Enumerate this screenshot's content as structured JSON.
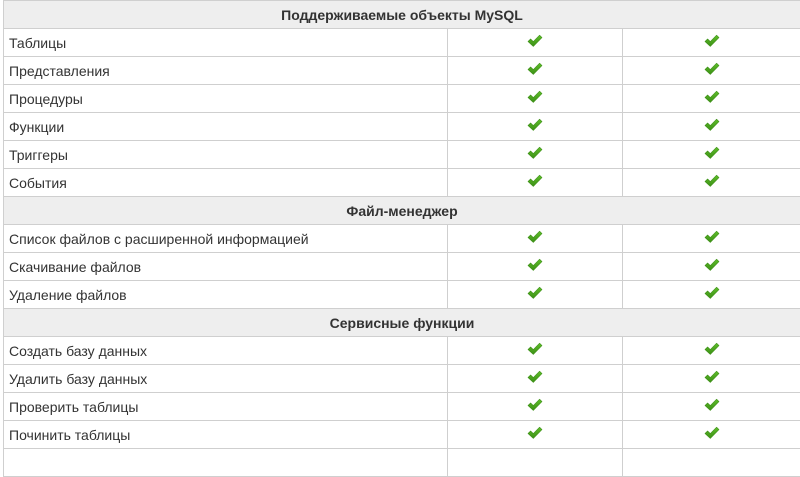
{
  "table": {
    "sections": [
      {
        "title": "Поддерживаемые объекты MySQL",
        "rows": [
          {
            "label": "Таблицы",
            "col1": "check",
            "col2": "check"
          },
          {
            "label": "Представления",
            "col1": "check",
            "col2": "check"
          },
          {
            "label": "Процедуры",
            "col1": "check",
            "col2": "check"
          },
          {
            "label": "Функции",
            "col1": "check",
            "col2": "check"
          },
          {
            "label": "Триггеры",
            "col1": "check",
            "col2": "check"
          },
          {
            "label": "События",
            "col1": "check",
            "col2": "check"
          }
        ]
      },
      {
        "title": "Файл-менеджер",
        "rows": [
          {
            "label": "Список файлов с расширенной информацией",
            "col1": "check",
            "col2": "check"
          },
          {
            "label": "Скачивание файлов",
            "col1": "check",
            "col2": "check"
          },
          {
            "label": "Удаление файлов",
            "col1": "check",
            "col2": "check"
          }
        ]
      },
      {
        "title": "Сервисные функции",
        "rows": [
          {
            "label": "Создать базу данных",
            "col1": "check",
            "col2": "check"
          },
          {
            "label": "Удалить базу данных",
            "col1": "check",
            "col2": "check"
          },
          {
            "label": "Проверить таблицы",
            "col1": "check",
            "col2": "check"
          },
          {
            "label": "Починить таблицы",
            "col1": "check",
            "col2": "check"
          }
        ]
      }
    ]
  },
  "colors": {
    "check": "#5fbf2a",
    "check_dark": "#3c8f16",
    "header_bg": "#eeeeee",
    "border": "#cfcfcf"
  },
  "icons": {
    "check": "checkmark-icon"
  }
}
